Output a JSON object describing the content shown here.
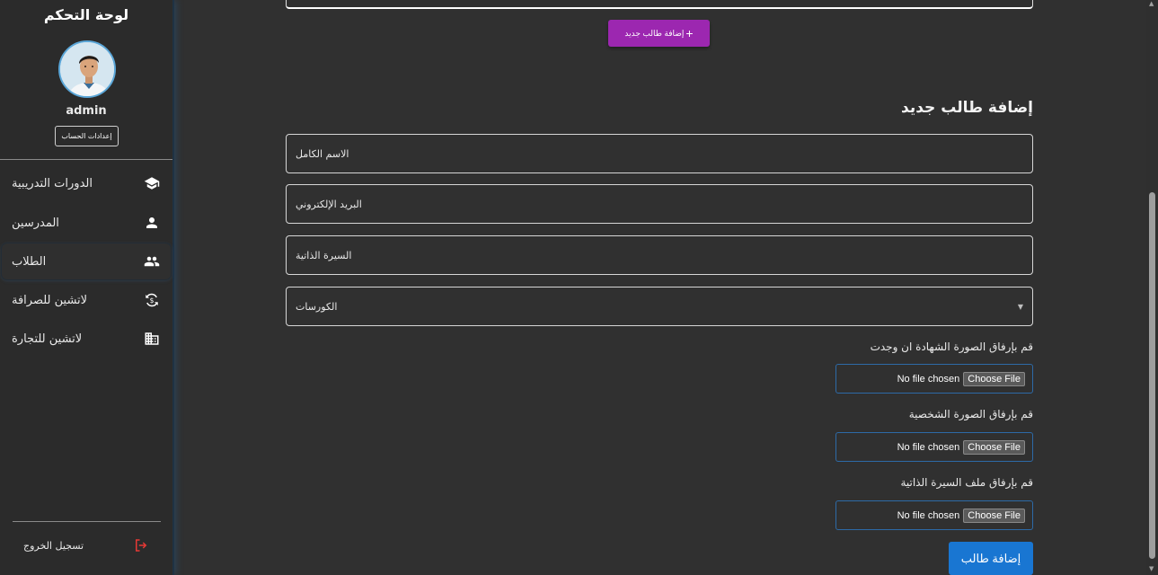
{
  "sidebar": {
    "title": "لوحة التحكم",
    "username": "admin",
    "account_settings": "إعدادات الحساب",
    "items": [
      {
        "label": "الدورات التدريبية",
        "icon": "graduation-cap-icon"
      },
      {
        "label": "المدرسين",
        "icon": "person-icon"
      },
      {
        "label": "الطلاب",
        "icon": "people-icon"
      },
      {
        "label": "لاتشين للصرافة",
        "icon": "currency-exchange-icon"
      },
      {
        "label": "لاتشين للتجارة",
        "icon": "building-icon"
      }
    ],
    "active_item": "الطلاب",
    "logout": "تسجيل الخروج"
  },
  "main": {
    "add_new_button": "إضافة طالب جديد",
    "form_title": "إضافة طالب جديد",
    "fields": {
      "full_name": "الاسم الكامل",
      "email": "البريد الإلكتروني",
      "cv": "السيرة الذاتية",
      "courses": "الكورسات"
    },
    "uploads": [
      {
        "label": "قم بإرفاق الصورة الشهادة ان وجدت",
        "status": "No file chosen",
        "button": "Choose File"
      },
      {
        "label": "قم بإرفاق الصورة الشخصية",
        "status": "No file chosen",
        "button": "Choose File"
      },
      {
        "label": "قم بإرفاق ملف السيرة الذاتية",
        "status": "No file chosen",
        "button": "Choose File"
      }
    ],
    "submit": "إضافة طالب"
  },
  "colors": {
    "add_new_button": "#9c27b0",
    "submit_button": "#1976d2",
    "logout_icon": "#e53935",
    "background": "#303030"
  }
}
